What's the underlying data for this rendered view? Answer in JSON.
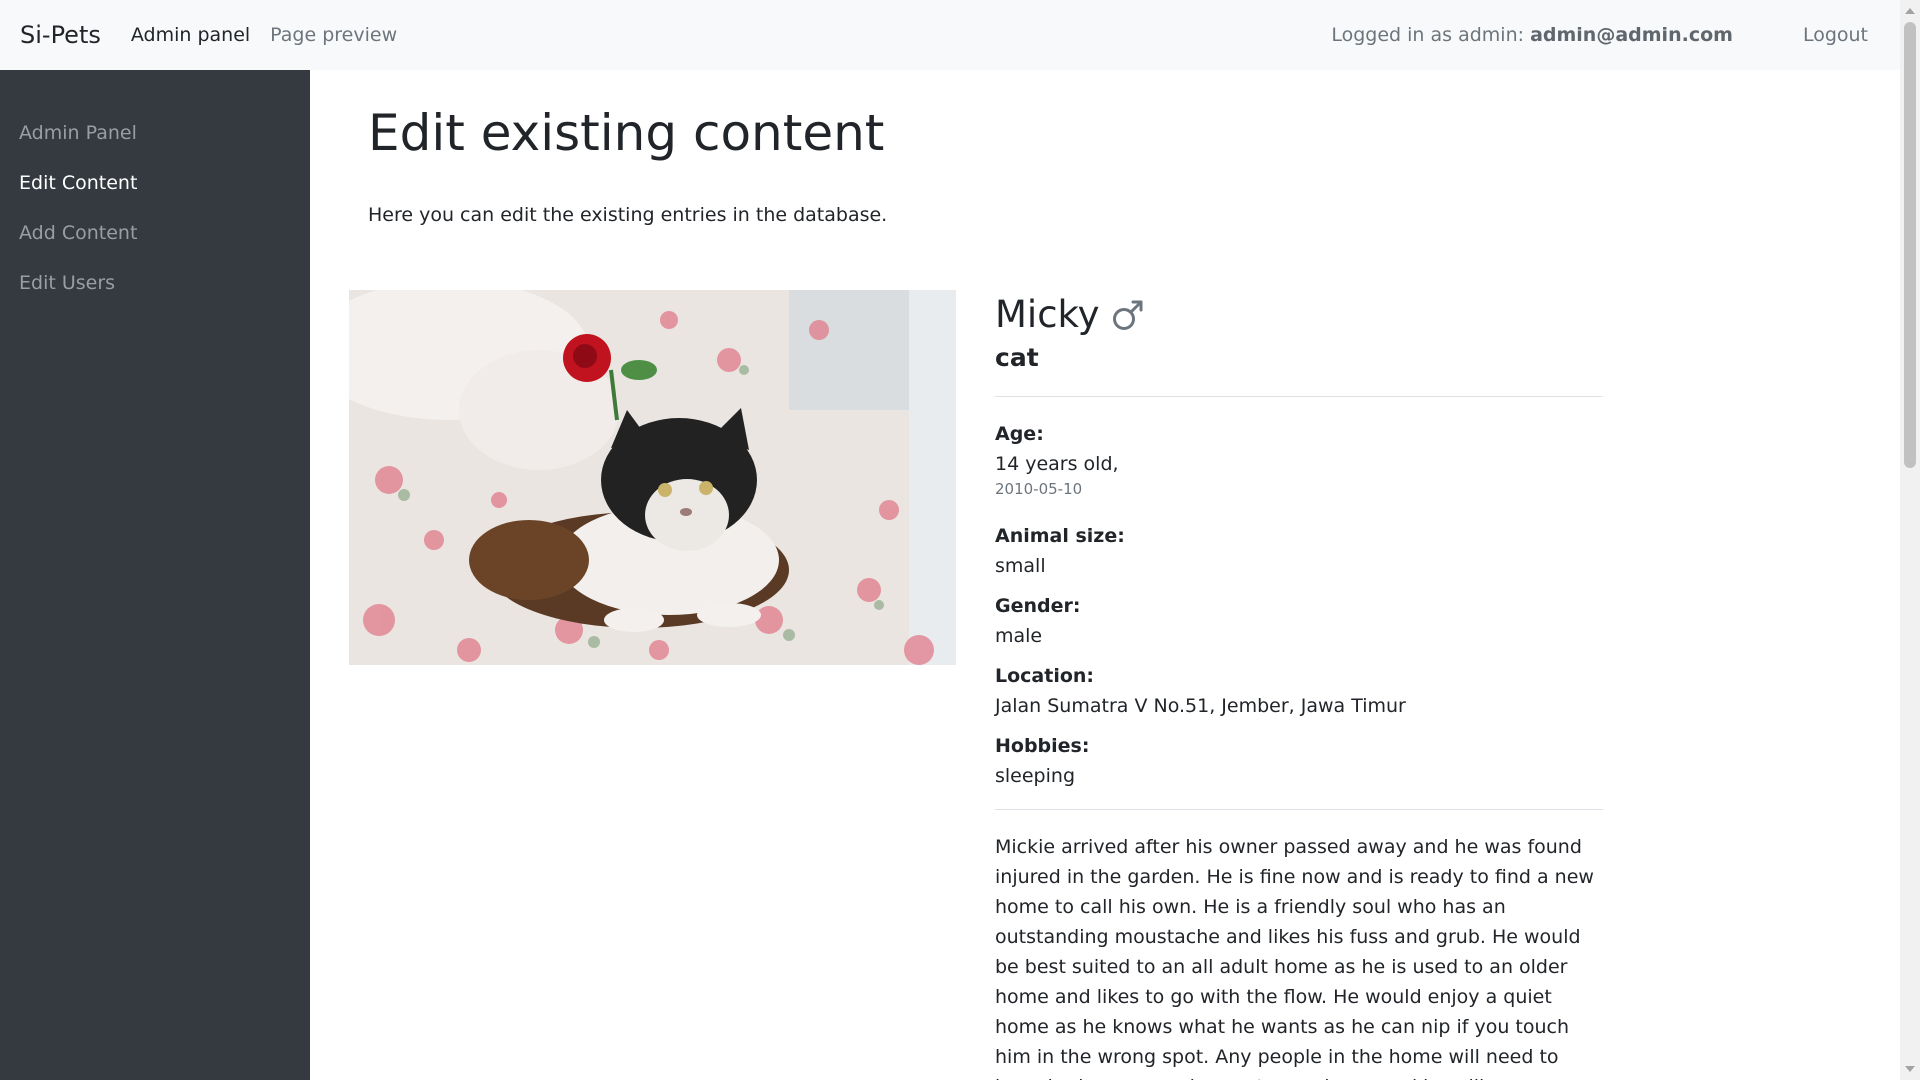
{
  "navbar": {
    "brand": "Si-Pets",
    "admin_panel": "Admin panel",
    "page_preview": "Page preview",
    "login_prefix": "Logged in as admin:",
    "login_email": "admin@admin.com",
    "logout": "Logout"
  },
  "sidebar": {
    "items": [
      {
        "label": "Admin Panel"
      },
      {
        "label": "Edit Content"
      },
      {
        "label": "Add Content"
      },
      {
        "label": "Edit Users"
      }
    ]
  },
  "main": {
    "title": "Edit existing content",
    "lead": "Here you can edit the existing entries in the database."
  },
  "pet": {
    "name": "Micky",
    "gender_icon": "male-icon",
    "species": "cat",
    "age_label": "Age:",
    "age_value": "14 years old,",
    "birth_date": "2010-05-10",
    "size_label": "Animal size:",
    "size_value": "small",
    "gender_label": "Gender:",
    "gender_value": "male",
    "location_label": "Location:",
    "location_value": "Jalan Sumatra V No.51, Jember, Jawa Timur",
    "hobbies_label": "Hobbies:",
    "hobbies_value": "sleeping",
    "description": "Mickie arrived after his owner passed away and he was found injured in the garden. He is fine now and is ready to find a new home to call his own. He is a friendly soul who has an outstanding moustache and likes his fuss and grub. He would be best suited to an all adult home as he is used to an older home and likes to go with the flow. He would enjoy a quiet home as he knows what he wants as he can nip if you touch him in the wrong spot. Any people in the home will need to have had some previous cat experience and he will"
  },
  "colors": {
    "navbar_bg": "#f8f9fa",
    "sidebar_bg": "#343a40",
    "sidebar_active": "#ffffff",
    "sidebar_inactive": "#9a9ea2"
  }
}
